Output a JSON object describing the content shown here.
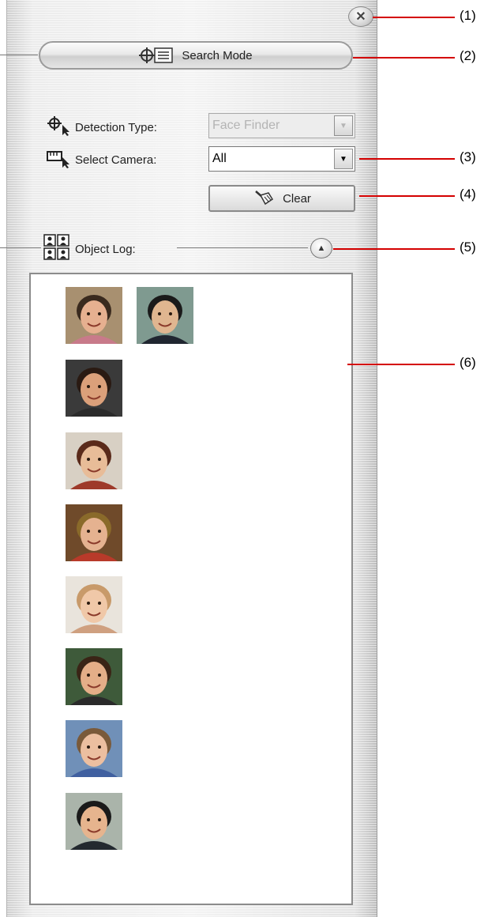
{
  "panel": {
    "search_mode_label": "Search Mode",
    "detection_type_label": "Detection Type:",
    "detection_type_value": "Face Finder",
    "select_camera_label": "Select Camera:",
    "select_camera_value": "All",
    "clear_label": "Clear",
    "object_log_label": "Object Log:"
  },
  "faces": [
    {
      "name": "face-girl-pigtails",
      "skin": "#e6b090",
      "hair": "#3a2a1e",
      "bg": "#a89070",
      "cloth": "#c87a8a"
    },
    {
      "name": "face-man-suit",
      "skin": "#e0b690",
      "hair": "#1a1a1a",
      "bg": "#7f9a90",
      "cloth": "#202630"
    },
    {
      "name": "face-child-dark-hat",
      "skin": "#dba07a",
      "hair": "#2a1a12",
      "bg": "#3a3a3a",
      "cloth": "#2b2b2b"
    },
    {
      "name": "face-child-cowboy-hat",
      "skin": "#e8bc98",
      "hair": "#5a2a1a",
      "bg": "#d8d0c4",
      "cloth": "#9e3a2a"
    },
    {
      "name": "face-child-gold-hat",
      "skin": "#e5b290",
      "hair": "#8a6a2a",
      "bg": "#6f4a2a",
      "cloth": "#b83a2a"
    },
    {
      "name": "face-girl-glasses",
      "skin": "#f0c8a8",
      "hair": "#c89a6a",
      "bg": "#e9e4dc",
      "cloth": "#cfa080"
    },
    {
      "name": "face-boy-glasses",
      "skin": "#e4ae88",
      "hair": "#3a2416",
      "bg": "#3e5a3a",
      "cloth": "#2a2a2a"
    },
    {
      "name": "face-girl-blue-hat",
      "skin": "#ecbfa0",
      "hair": "#7a5a3a",
      "bg": "#7090b8",
      "cloth": "#4060a0"
    },
    {
      "name": "face-man-gray",
      "skin": "#e6b48e",
      "hair": "#1a1a1a",
      "bg": "#aab4aa",
      "cloth": "#23292f"
    }
  ],
  "callouts": [
    "(1)",
    "(2)",
    "(3)",
    "(4)",
    "(5)",
    "(6)"
  ],
  "colors": {
    "callout_line": "#d40000"
  }
}
